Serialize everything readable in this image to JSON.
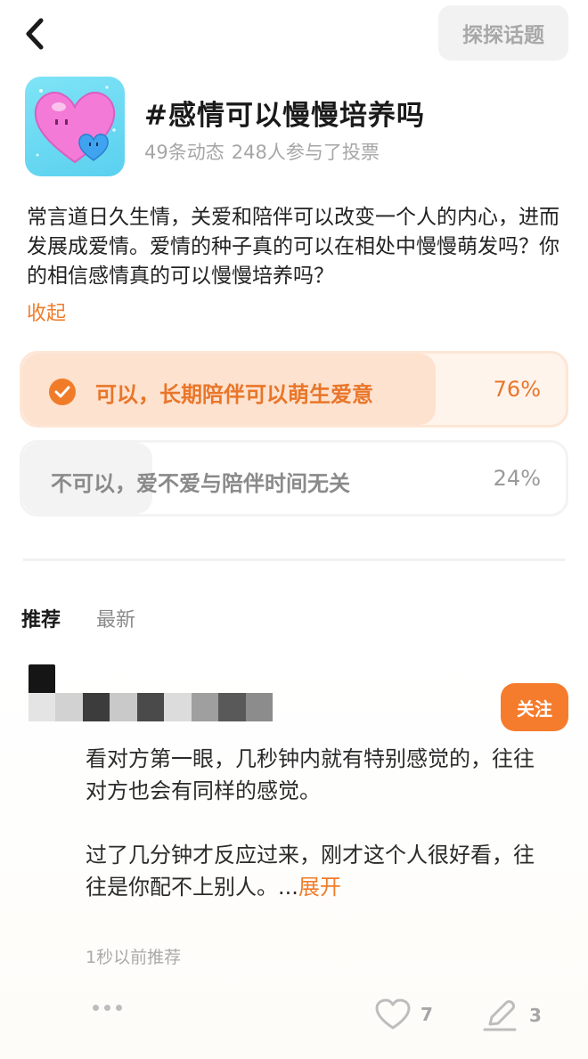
{
  "header": {
    "back_icon": "chevron-left-icon",
    "explore_label": "探探话题"
  },
  "topic": {
    "title": "#感情可以慢慢培养吗",
    "posts_count": "49条动态",
    "voters_count": "248人参与了投票",
    "description": "常言道日久生情，关爱和陪伴可以改变一个人的内心，进而发展成爱情。爱情的种子真的可以在相处中慢慢萌发吗？你的相信感情真的可以慢慢培养吗？",
    "collapse_label": "收起",
    "icon": "heart-topic-icon"
  },
  "poll": {
    "options": [
      {
        "label": "可以，长期陪伴可以萌生爱意",
        "percent": "76%",
        "fill_fraction": 0.76,
        "selected": true
      },
      {
        "label": "不可以，爱不爱与陪伴时间无关",
        "percent": "24%",
        "fill_fraction": 0.24,
        "selected": false
      }
    ]
  },
  "tabs": [
    {
      "label": "推荐",
      "active": true
    },
    {
      "label": "最新",
      "active": false
    }
  ],
  "post": {
    "follow_label": "关注",
    "paragraph1": "看对方第一眼，几秒钟内就有特别感觉的，往往对方也会有同样的感觉。",
    "paragraph2": "过了几分钟才反应过来，刚才这个人很好看，往往是你配不上别人。...",
    "expand_label": "展开",
    "time": "1秒以前推荐",
    "likes": "7",
    "comments": "3"
  },
  "colors": {
    "accent": "#f07c2a",
    "selected_fill": "#fde2cf",
    "unselected_fill": "#f3f3f3"
  }
}
